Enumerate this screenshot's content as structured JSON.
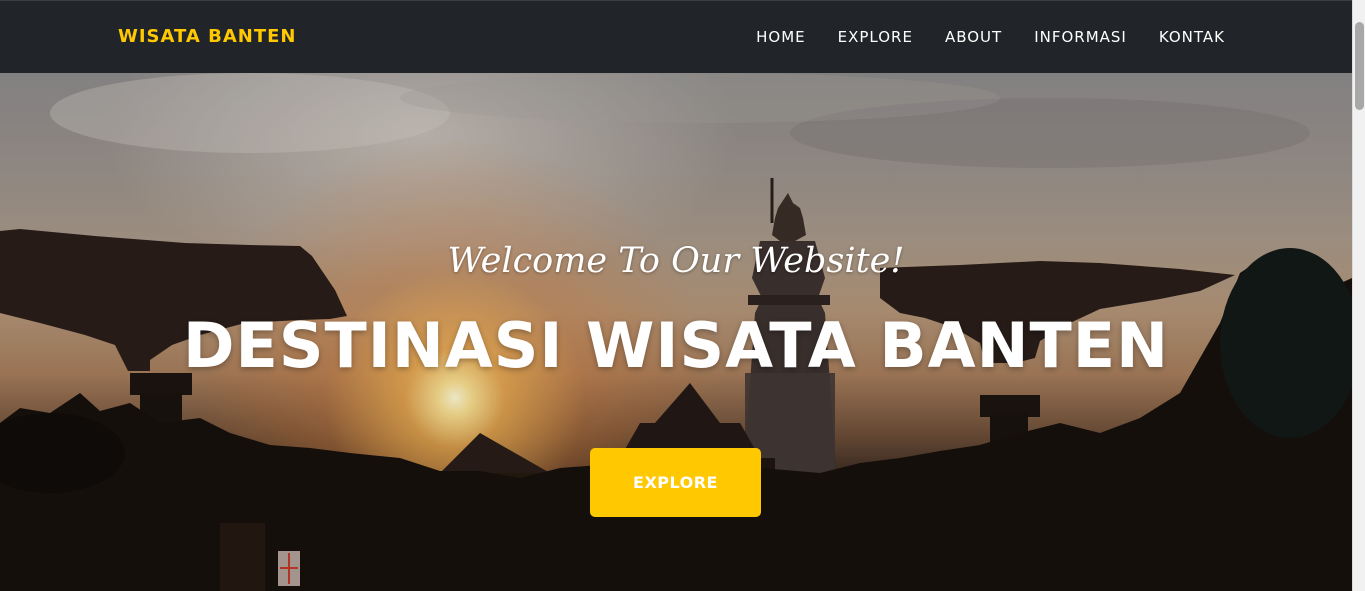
{
  "navbar": {
    "brand": "WISATA BANTEN",
    "links": [
      "HOME",
      "EXPLORE",
      "ABOUT",
      "INFORMASI",
      "KONTAK"
    ]
  },
  "hero": {
    "subheading": "Welcome To Our Website!",
    "heading": "DESTINASI WISATA BANTEN",
    "button_label": "EXPLORE",
    "image": "sunset-silhouette-mosque-and-umbrella-canopies"
  },
  "colors": {
    "navbar_bg": "#212529",
    "accent": "#ffc800",
    "text_light": "#ffffff"
  }
}
